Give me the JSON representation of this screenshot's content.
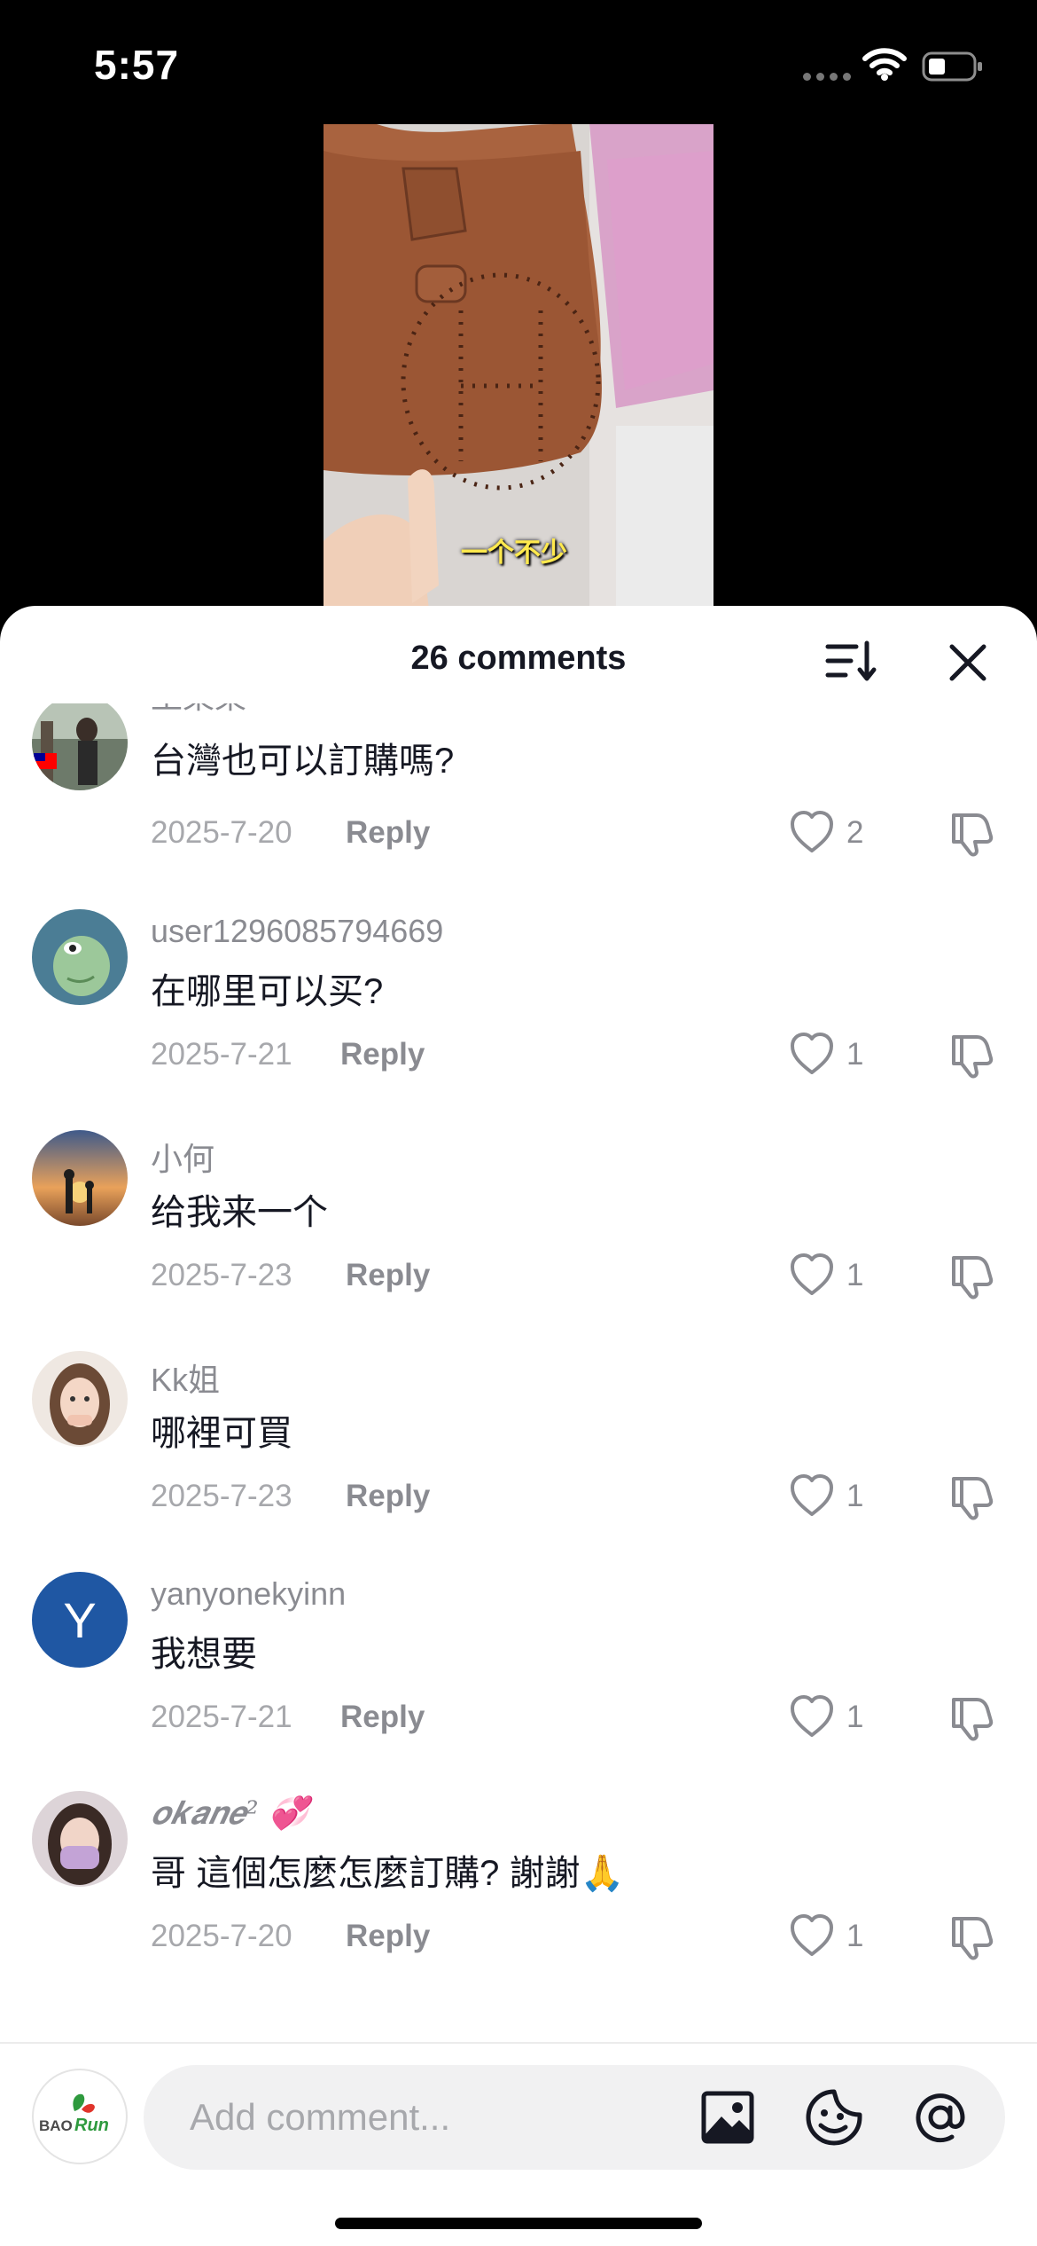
{
  "status_bar": {
    "time": "5:57"
  },
  "video": {
    "caption": "一个不少"
  },
  "sheet": {
    "title": "26 comments"
  },
  "comments": [
    {
      "username": "王某某",
      "text": "台灣也可以訂購嗎?",
      "date": "2025-7-20",
      "reply": "Reply",
      "likes": "2"
    },
    {
      "username": "user1296085794669",
      "text": "在哪里可以买?",
      "date": "2025-7-21",
      "reply": "Reply",
      "likes": "1"
    },
    {
      "username": "小何",
      "text": "给我来一个",
      "date": "2025-7-23",
      "reply": "Reply",
      "likes": "1"
    },
    {
      "username": "Kk姐",
      "text": "哪裡可買",
      "date": "2025-7-23",
      "reply": "Reply",
      "likes": "1"
    },
    {
      "username": "yanyonekyinn",
      "avatar_letter": "Y",
      "text": "我想要",
      "date": "2025-7-21",
      "reply": "Reply",
      "likes": "1"
    },
    {
      "username": "𝒐𝒌𝒂𝒏𝒆² 💞",
      "text": "哥 這個怎麼怎麼訂購? 謝謝🙏",
      "date": "2025-7-20",
      "reply": "Reply",
      "likes": "1"
    }
  ],
  "bottom_bar": {
    "input_placeholder": "Add comment...",
    "my_avatar_logo": "BAORun"
  },
  "colors": {
    "text_primary": "#161823",
    "text_secondary": "#8a8b91",
    "text_tertiary": "#a7a8ac",
    "avatar_y": "#1f57a3"
  }
}
